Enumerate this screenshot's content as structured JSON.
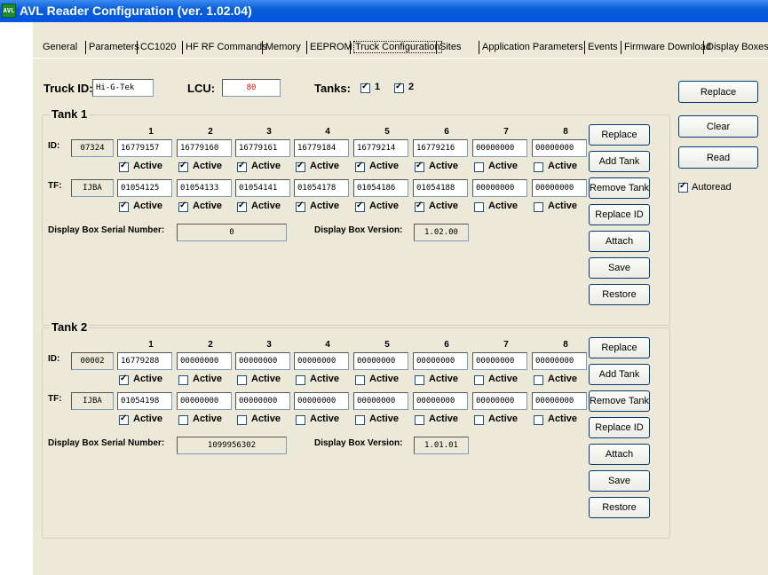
{
  "window": {
    "title": "AVL Reader Configuration (ver. 1.02.04)",
    "icon": "app-icon"
  },
  "tabs": [
    "General",
    "Parameters",
    "CC1020",
    "HF RF Commands",
    "Memory",
    "EEPROM",
    "Truck Configuration",
    "Sites",
    "Application Parameters",
    "Events",
    "Firmware Download",
    "Display Boxes"
  ],
  "active_tab": "Truck Configuration",
  "header": {
    "truck_id_label": "Truck ID:",
    "truck_id_value": "Hi-G-Tek",
    "lcu_label": "LCU:",
    "lcu_value": "80",
    "tanks_label": "Tanks:",
    "tank1_check_label": "1",
    "tank1_checked": true,
    "tank2_check_label": "2",
    "tank2_checked": true
  },
  "right_panel": {
    "replace": "Replace",
    "clear": "Clear",
    "read": "Read",
    "autoread_label": "Autoread",
    "autoread_checked": true
  },
  "columns": [
    "1",
    "2",
    "3",
    "4",
    "5",
    "6",
    "7",
    "8"
  ],
  "active_label": "Active",
  "tanks": [
    {
      "title": "Tank 1",
      "id_label": "ID:",
      "id_value": "07324",
      "ids": [
        "16779157",
        "16779160",
        "16779161",
        "16779184",
        "16779214",
        "16779216",
        "00000000",
        "00000000"
      ],
      "ids_active": [
        true,
        true,
        true,
        true,
        true,
        true,
        false,
        false
      ],
      "tf_label": "TF:",
      "tf_value": "IJBA",
      "tfs": [
        "01054125",
        "01054133",
        "01054141",
        "01054178",
        "01054186",
        "01054188",
        "00000000",
        "00000000"
      ],
      "tfs_active": [
        true,
        true,
        true,
        true,
        true,
        true,
        false,
        false
      ],
      "serial_label": "Display Box Serial Number:",
      "serial_value": "0",
      "version_label": "Display Box Version:",
      "version_value": "1.02.00",
      "buttons": [
        "Replace",
        "Add Tank",
        "Remove Tank",
        "Replace ID",
        "Attach",
        "Save",
        "Restore"
      ]
    },
    {
      "title": "Tank 2",
      "id_label": "ID:",
      "id_value": "00002",
      "ids": [
        "16779288",
        "00000000",
        "00000000",
        "00000000",
        "00000000",
        "00000000",
        "00000000",
        "00000000"
      ],
      "ids_active": [
        true,
        false,
        false,
        false,
        false,
        false,
        false,
        false
      ],
      "tf_label": "TF:",
      "tf_value": "IJBA",
      "tfs": [
        "01054198",
        "00000000",
        "00000000",
        "00000000",
        "00000000",
        "00000000",
        "00000000",
        "00000000"
      ],
      "tfs_active": [
        true,
        false,
        false,
        false,
        false,
        false,
        false,
        false
      ],
      "serial_label": "Display Box Serial Number:",
      "serial_value": "1099956302",
      "version_label": "Display Box Version:",
      "version_value": "1.01.01",
      "buttons": [
        "Replace",
        "Add Tank",
        "Remove Tank",
        "Replace ID",
        "Attach",
        "Save",
        "Restore"
      ]
    }
  ]
}
